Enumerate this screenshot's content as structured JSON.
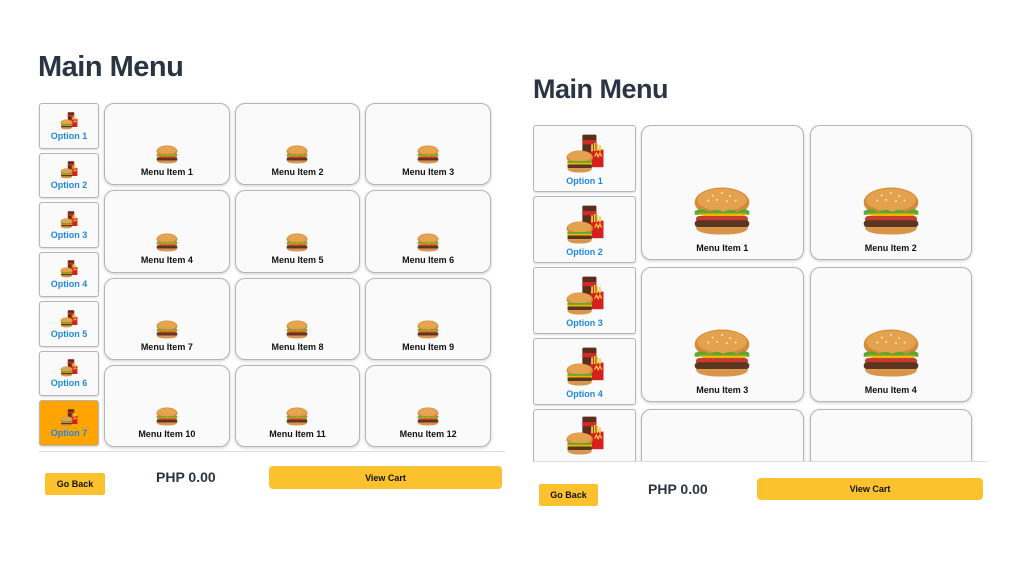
{
  "left": {
    "title": "Main Menu",
    "options": [
      {
        "label": "Option 1",
        "active": false
      },
      {
        "label": "Option 2",
        "active": false
      },
      {
        "label": "Option 3",
        "active": false
      },
      {
        "label": "Option 4",
        "active": false
      },
      {
        "label": "Option 5",
        "active": false
      },
      {
        "label": "Option 6",
        "active": false
      },
      {
        "label": "Option 7",
        "active": true
      }
    ],
    "items": [
      "Menu Item 1",
      "Menu Item 2",
      "Menu Item 3",
      "Menu Item 4",
      "Menu Item 5",
      "Menu Item 6",
      "Menu Item 7",
      "Menu Item 8",
      "Menu Item 9",
      "Menu Item 10",
      "Menu Item 11",
      "Menu Item 12"
    ],
    "back_label": "Go Back",
    "price": "PHP 0.00",
    "cart_label": "View Cart"
  },
  "right": {
    "title": "Main Menu",
    "options": [
      {
        "label": "Option 1"
      },
      {
        "label": "Option 2"
      },
      {
        "label": "Option 3"
      },
      {
        "label": "Option 4"
      },
      {
        "label": ""
      }
    ],
    "items": [
      "Menu Item 1",
      "Menu Item 2",
      "Menu Item 3",
      "Menu Item 4",
      "",
      ""
    ],
    "back_label": "Go Back",
    "price": "PHP 0.00",
    "cart_label": "View Cart"
  },
  "icons": {
    "option": "burger-meal-icon",
    "item": "burger-icon"
  },
  "colors": {
    "accent": "#fcc22e",
    "active_option": "#ffa400",
    "option_text": "#1e88e5",
    "title": "#2a3442"
  }
}
